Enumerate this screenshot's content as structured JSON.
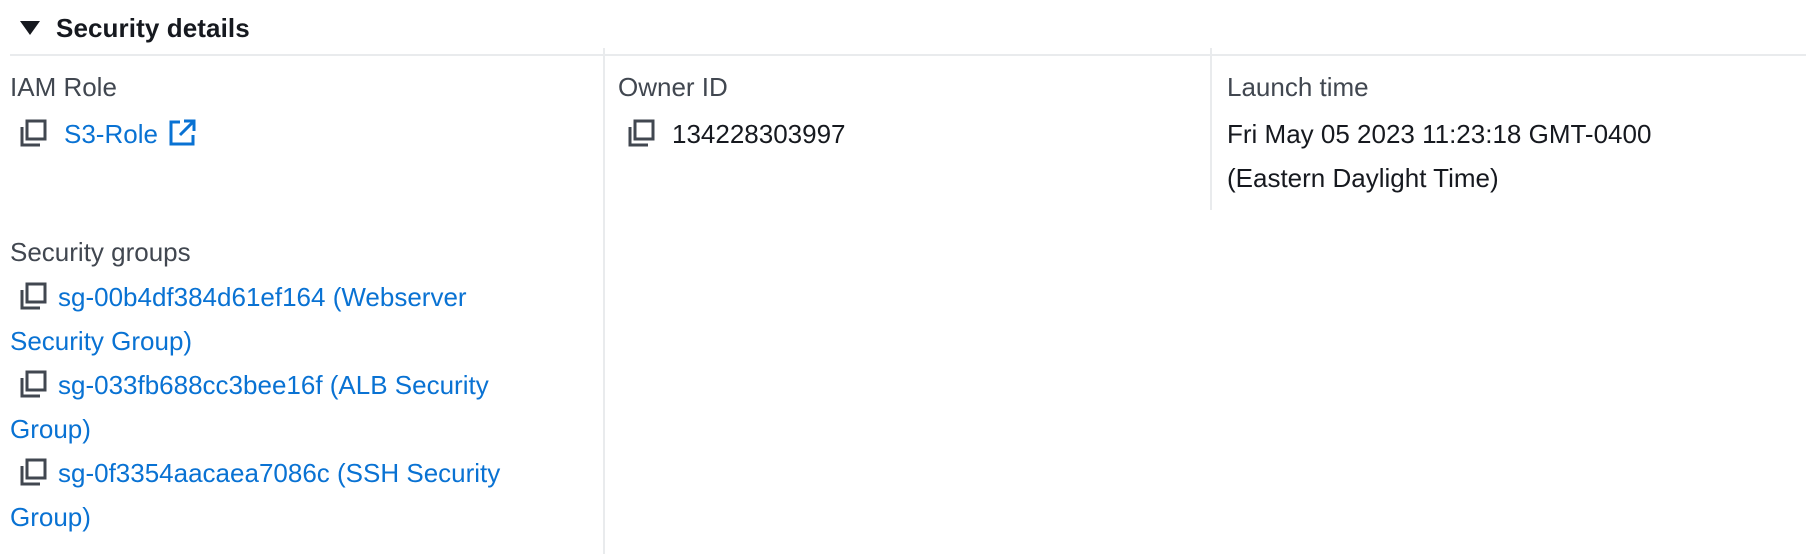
{
  "section": {
    "title": "Security details"
  },
  "iam_role": {
    "label": "IAM Role",
    "value": "S3-Role"
  },
  "owner_id": {
    "label": "Owner ID",
    "value": "134228303997"
  },
  "launch_time": {
    "label": "Launch time",
    "line1": "Fri May 05 2023 11:23:18 GMT-0400",
    "line2": "(Eastern Daylight Time)"
  },
  "security_groups": {
    "label": "Security groups",
    "items": [
      {
        "line1": "sg-00b4df384d61ef164 (Webserver",
        "line2": "Security Group)"
      },
      {
        "line1": "sg-033fb688cc3bee16f (ALB Security",
        "line2": "Group)"
      },
      {
        "line1": "sg-0f3354aacaea7086c (SSH Security",
        "line2": "Group)"
      }
    ]
  },
  "colors": {
    "link": "#0972d3",
    "label": "#414750",
    "text": "#16191f",
    "divider": "#e9ebed"
  },
  "icons": {
    "copy": "copy-icon",
    "external": "external-link-icon",
    "caret": "caret-down-icon"
  }
}
